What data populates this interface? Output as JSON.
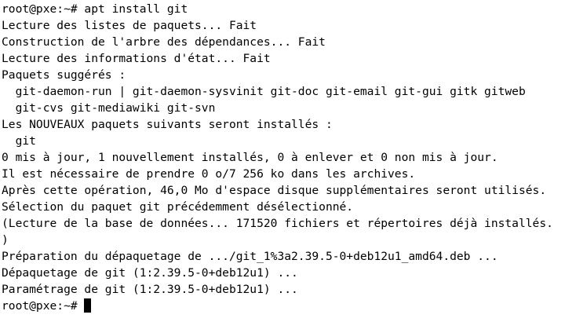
{
  "terminal": {
    "lines": [
      "root@pxe:~# apt install git",
      "Lecture des listes de paquets... Fait",
      "Construction de l'arbre des dépendances... Fait",
      "Lecture des informations d'état... Fait",
      "Paquets suggérés :",
      "  git-daemon-run | git-daemon-sysvinit git-doc git-email git-gui gitk gitweb",
      "  git-cvs git-mediawiki git-svn",
      "Les NOUVEAUX paquets suivants seront installés :",
      "  git",
      "0 mis à jour, 1 nouvellement installés, 0 à enlever et 0 non mis à jour.",
      "Il est nécessaire de prendre 0 o/7 256 ko dans les archives.",
      "Après cette opération, 46,0 Mo d'espace disque supplémentaires seront utilisés.",
      "Sélection du paquet git précédemment désélectionné.",
      "(Lecture de la base de données... 171520 fichiers et répertoires déjà installés.",
      ")",
      "Préparation du dépaquetage de .../git_1%3a2.39.5-0+deb12u1_amd64.deb ...",
      "Dépaquetage de git (1:2.39.5-0+deb12u1) ...",
      "Paramétrage de git (1:2.39.5-0+deb12u1) ..."
    ],
    "prompt": "root@pxe:~# ",
    "colors": {
      "background": "#ffffff",
      "foreground": "#000000",
      "cursor": "#000000"
    }
  }
}
